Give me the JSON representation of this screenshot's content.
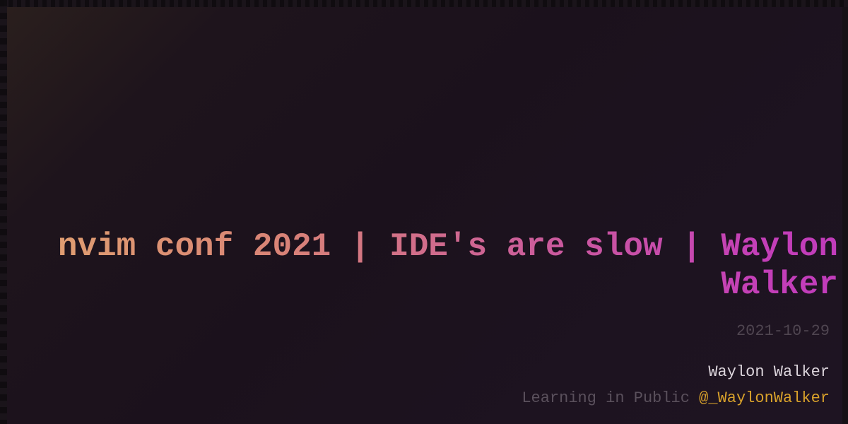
{
  "post": {
    "title": "nvim conf 2021 | IDE's are slow | Waylon Walker",
    "date": "2021-10-29"
  },
  "footer": {
    "author": "Waylon Walker",
    "tagline_prefix": "Learning in Public",
    "handle": "@_WaylonWalker"
  },
  "colors": {
    "background": "#1b111c",
    "title_gradient_start": "#e0a070",
    "title_gradient_end": "#c13cbb",
    "date": "#4f4550",
    "author": "#ddd6dd",
    "tagline": "#5a505c",
    "handle": "#d9a22b"
  }
}
